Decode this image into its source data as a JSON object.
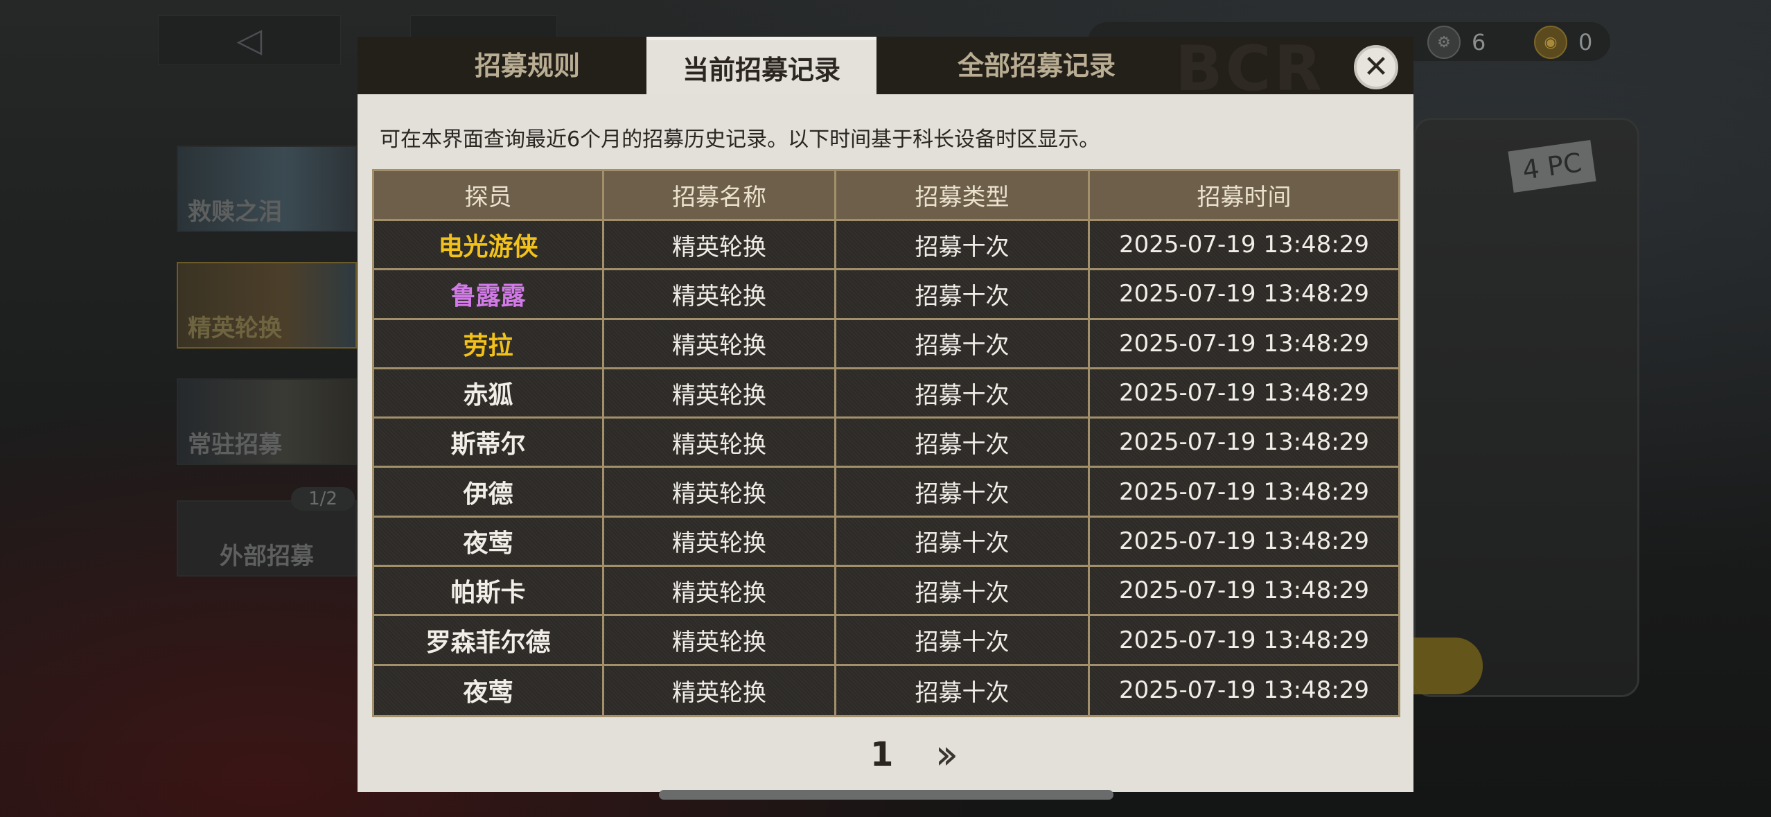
{
  "background": {
    "currencies": [
      {
        "icon": "gear-coin-icon",
        "value": "6"
      },
      {
        "icon": "gold-coin-icon",
        "value": "0"
      }
    ],
    "side_banners": [
      "救赎之泪",
      "精英轮换",
      "常驻招募",
      "外部招募"
    ],
    "outer_count": "1/2",
    "device_label": "4 PC"
  },
  "modal": {
    "tabs": [
      {
        "label": "招募规则",
        "active": false
      },
      {
        "label": "当前招募记录",
        "active": true
      },
      {
        "label": "全部招募记录",
        "active": false
      }
    ],
    "watermark": "BCR",
    "notice": "可在本界面查询最近6个月的招募历史记录。以下时间基于科长设备时区显示。",
    "table": {
      "headers": [
        "探员",
        "招募名称",
        "招募类型",
        "招募时间"
      ],
      "rows": [
        {
          "agent": "电光游侠",
          "agent_color": "#f2c21b",
          "name": "精英轮换",
          "type": "招募十次",
          "time": "2025-07-19 13:48:29"
        },
        {
          "agent": "鲁露露",
          "agent_color": "#d27ae8",
          "name": "精英轮换",
          "type": "招募十次",
          "time": "2025-07-19 13:48:29"
        },
        {
          "agent": "劳拉",
          "agent_color": "#f2c21b",
          "name": "精英轮换",
          "type": "招募十次",
          "time": "2025-07-19 13:48:29"
        },
        {
          "agent": "赤狐",
          "agent_color": "#f1eee8",
          "name": "精英轮换",
          "type": "招募十次",
          "time": "2025-07-19 13:48:29"
        },
        {
          "agent": "斯蒂尔",
          "agent_color": "#f1eee8",
          "name": "精英轮换",
          "type": "招募十次",
          "time": "2025-07-19 13:48:29"
        },
        {
          "agent": "伊德",
          "agent_color": "#f1eee8",
          "name": "精英轮换",
          "type": "招募十次",
          "time": "2025-07-19 13:48:29"
        },
        {
          "agent": "夜莺",
          "agent_color": "#f1eee8",
          "name": "精英轮换",
          "type": "招募十次",
          "time": "2025-07-19 13:48:29"
        },
        {
          "agent": "帕斯卡",
          "agent_color": "#f1eee8",
          "name": "精英轮换",
          "type": "招募十次",
          "time": "2025-07-19 13:48:29"
        },
        {
          "agent": "罗森菲尔德",
          "agent_color": "#f1eee8",
          "name": "精英轮换",
          "type": "招募十次",
          "time": "2025-07-19 13:48:29"
        },
        {
          "agent": "夜莺",
          "agent_color": "#f1eee8",
          "name": "精英轮换",
          "type": "招募十次",
          "time": "2025-07-19 13:48:29"
        }
      ]
    },
    "pager": {
      "current_page": "1",
      "next_icon": "double-chevron-right-icon"
    }
  }
}
